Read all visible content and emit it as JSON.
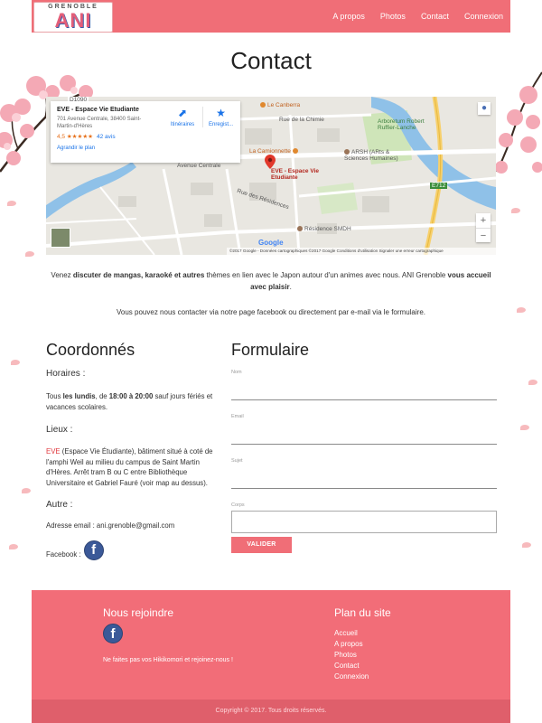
{
  "colors": {
    "accent": "#f06e77",
    "footer": "#f26d78",
    "footer_bottom": "#df5f6b",
    "facebook": "#3b5998"
  },
  "header": {
    "logo_top": "GRENOBLE",
    "logo_main": "ANI",
    "nav": [
      "A propos",
      "Photos",
      "Contact",
      "Connexion"
    ]
  },
  "page": {
    "title": "Contact"
  },
  "map": {
    "card_title": "EVE - Espace Vie Etudiante",
    "card_address": "701 Avenue Centrale, 38400 Saint-Martin-d'Hères",
    "card_rating": "4,5 ★★★★★",
    "card_reviews": "42 avis",
    "card_enlarge": "Agrandir le plan",
    "action_directions": "Itinéraires",
    "action_save": "Enregist...",
    "labels": {
      "canberra": "Le Canberra",
      "chimie": "Rue de la Chimie",
      "arboretum": "Arboretum Robert Ruffier-Lanche",
      "camionnette": "La Camionnette",
      "arsh": "ARSH (ARts & Sciences Humaines)",
      "eve": "EVE - Espace Vie Etudiante",
      "avenue": "Avenue Centrale",
      "residence": "Résidence SMDH",
      "residences": "Rue des Résidences",
      "d1090": "D1090",
      "e712": "E712"
    },
    "google": "Google",
    "attribution": "©2017 Google - Données cartographiques ©2017 Google   Conditions d'utilisation   Signaler une erreur cartographique",
    "zoom_in": "+",
    "zoom_out": "−"
  },
  "intro": {
    "line1_a": "Venez ",
    "line1_b": "discuter de mangas, karaoké et autres",
    "line1_c": " thèmes en lien avec le Japon autour d'un animes avec nous. ANI Grenoble ",
    "line1_d": "vous accueil avec plaisir",
    "line1_e": ".",
    "line2": "Vous pouvez nous contacter via notre page facebook ou directement par e-mail via le formulaire."
  },
  "coords": {
    "title": "Coordonnés",
    "horaires_label": "Horaires :",
    "horaires_a": "Tous ",
    "horaires_b": "les lundis",
    "horaires_c": ", de ",
    "horaires_d": "18:00 à 20:00",
    "horaires_e": " sauf jours fériés et vacances scolaires.",
    "lieux_label": "Lieux :",
    "lieux_eve": "EVE",
    "lieux_text": " (Espace Vie Étudiante), bâtiment situé à coté de l'amphi Weil au milieu du campus de Saint Martin d'Hères. Arrêt tram B ou C entre Bibliothèque Universitaire et Gabriel Fauré (voir map au dessus).",
    "autre_label": "Autre :",
    "email_line": "Adresse email : ani.grenoble@gmail.com",
    "facebook_label": "Facebook :",
    "fb_glyph": "f"
  },
  "form": {
    "title": "Formulaire",
    "nom": "Nom",
    "email": "Email",
    "sujet": "Sujet",
    "corps": "Corps",
    "submit": "VALIDER"
  },
  "footer": {
    "join_title": "Nous rejoindre",
    "join_text": "Ne faites pas vos Hikikomori et rejoinez-nous !",
    "plan_title": "Plan du site",
    "plan_links": [
      "Accueil",
      "A propos",
      "Photos",
      "Contact",
      "Connexion"
    ],
    "copyright": "Copyright © 2017. Tous droits réservés.",
    "fb_glyph": "f"
  }
}
